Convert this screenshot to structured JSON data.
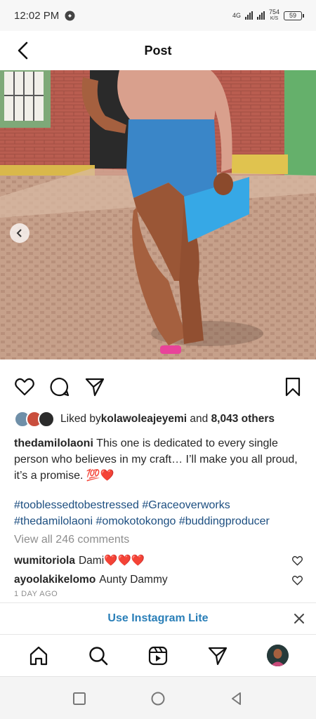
{
  "status_bar": {
    "time": "12:02 PM",
    "network": "4G",
    "speed": "754",
    "speed_unit": "K/S",
    "battery": "59"
  },
  "header": {
    "title": "Post"
  },
  "post": {
    "liked_by_prefix": "Liked by ",
    "liked_by_user": "kolawoleajeyemi",
    "liked_by_and": " and ",
    "liked_by_count": "8,043 others",
    "caption_user": "thedamilolaoni",
    "caption_text": " This one is dedicated to every single person who believes in my craft… I’ll make you all proud, it’s a promise. 💯❤️",
    "hashtags": [
      "#tooblessedtobestressed",
      "#Graceoverworks",
      "#thedamilolaoni",
      "#omokotokongo",
      "#buddingproducer"
    ],
    "view_comments": "View all 246 comments",
    "comments": [
      {
        "user": "wumitoriola",
        "text": "Dami❤️❤️❤️"
      },
      {
        "user": "ayoolakikelomo",
        "text": "Aunty Dammy"
      }
    ],
    "time_ago": "1 DAY AGO"
  },
  "banner": {
    "text": "Use Instagram Lite"
  },
  "colors": {
    "link": "#1c4e80",
    "banner": "#2a7fb8",
    "muted": "#8e8e8e"
  }
}
